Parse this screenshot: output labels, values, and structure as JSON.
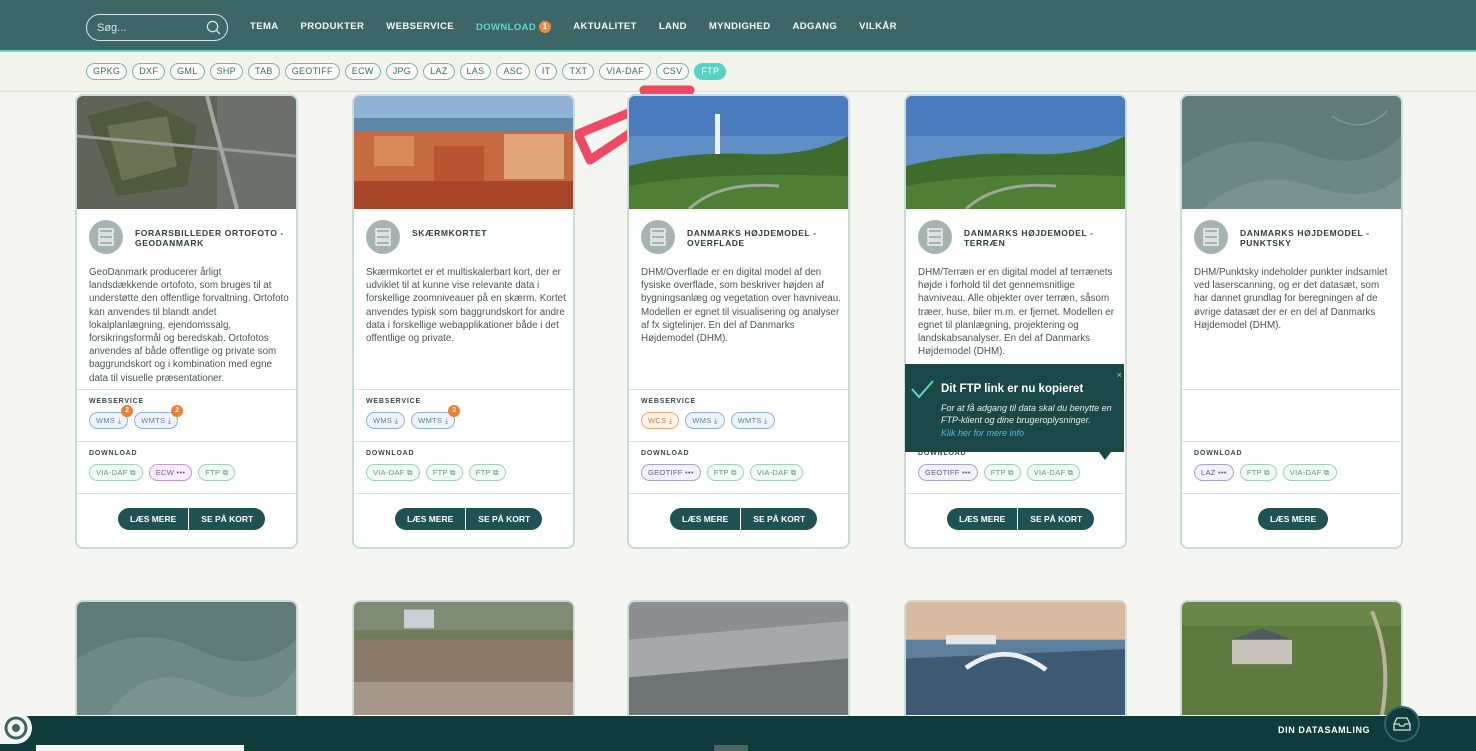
{
  "search": {
    "placeholder": "Søg..."
  },
  "nav": {
    "items": [
      "TEMA",
      "PRODUKTER",
      "WEBSERVICE",
      "DOWNLOAD",
      "AKTUALITET",
      "LAND",
      "MYNDIGHED",
      "ADGANG",
      "VILKÅR"
    ],
    "download_badge": "1"
  },
  "formats": [
    "GPKG",
    "DXF",
    "GML",
    "SHP",
    "TAB",
    "GEOTIFF",
    "ECW",
    "JPG",
    "LAZ",
    "LAS",
    "ASC",
    "IT",
    "TXT",
    "VIA-DAF",
    "CSV",
    "FTP"
  ],
  "active_format": "FTP",
  "section_labels": {
    "webservice": "WEBSERVICE",
    "download": "DOWNLOAD"
  },
  "buttons": {
    "read_more": "LÆS MERE",
    "see_map": "SE PÅ KORT"
  },
  "cards": [
    {
      "title": "FORARSBILLEDER ORTOFOTO - GEODANMARK",
      "description": "GeoDanmark producerer årligt landsdækkende ortofoto, som bruges til at understøtte den offentlige forvaltning. Ortofoto kan anvendes til blandt andet lokalplanlægning, ejendomssalg, forsikringsformål og beredskab. Ortofotos anvendes af både offentlige og private som baggrundskort og i kombination med egne data til visuelle præsentationer.",
      "webservice": [
        {
          "label": "WMS ⤓",
          "count": "2"
        },
        {
          "label": "WMTS ⤓",
          "count": "2"
        }
      ],
      "download": [
        {
          "label": "VIA-DAF ⧉",
          "type": "dl"
        },
        {
          "label": "ECW •••",
          "type": "ecw"
        },
        {
          "label": "FTP ⧉",
          "type": "dl"
        }
      ]
    },
    {
      "title": "SKÆRMKORTET",
      "description": "Skærmkortet er et multiskalerbart kort, der er udviklet til at kunne vise relevante data i forskellige zoomniveauer på en skærm. Kortet anvendes typisk som baggrundskort for andre data i forskellige webapplikationer både i det offentlige og private.",
      "webservice": [
        {
          "label": "WMS ⤓",
          "count": ""
        },
        {
          "label": "WMTS ⤓",
          "count": "3"
        }
      ],
      "download": [
        {
          "label": "VIA-DAF ⧉",
          "type": "dl"
        },
        {
          "label": "FTP ⧉",
          "type": "dl"
        },
        {
          "label": "FTP ⧉",
          "type": "dl"
        }
      ]
    },
    {
      "title": "DANMARKS HØJDEMODEL - OVERFLADE",
      "description": "DHM/Overflade er en digital model af den fysiske overflade, som beskriver højden af bygningsanlæg og vegetation over havniveau. Modellen er egnet til visualisering og analyser af fx sigtelinjer. En del af Danmarks Højdemodel (DHM).",
      "webservice": [
        {
          "label": "WCS ⤓",
          "count": "",
          "type": "wcs"
        },
        {
          "label": "WMS ⤓",
          "count": ""
        },
        {
          "label": "WMTS ⤓",
          "count": ""
        }
      ],
      "download": [
        {
          "label": "GEOTIFF •••",
          "type": "geo"
        },
        {
          "label": "FTP ⧉",
          "type": "dl"
        },
        {
          "label": "VIA-DAF ⧉",
          "type": "dl"
        }
      ]
    },
    {
      "title": "DANMARKS HØJDEMODEL - TERRÆN",
      "description": "DHM/Terræn er en digital model af terrænets højde i forhold til det gennemsnitlige havniveau. Alle objekter over terræn, såsom træer, huse, biler m.m. er fjernet. Modellen er egnet til planlægning, projektering og landskabsanalyser. En del af Danmarks Højdemodel (DHM).",
      "webservice": [],
      "download": [
        {
          "label": "GEOTIFF •••",
          "type": "geo"
        },
        {
          "label": "FTP ⧉",
          "type": "dl"
        },
        {
          "label": "VIA-DAF ⧉",
          "type": "dl"
        }
      ]
    },
    {
      "title": "DANMARKS HØJDEMODEL - PUNKTSKY",
      "description": "DHM/Punktsky indeholder punkter indsamlet ved laserscanning, og er det datasæt, som har dannet grundlag for beregningen af de øvrige datasæt der er en del af Danmarks Højdemodel (DHM).",
      "webservice": [],
      "download": [
        {
          "label": "LAZ •••",
          "type": "geo"
        },
        {
          "label": "FTP ⧉",
          "type": "dl"
        },
        {
          "label": "VIA-DAF ⧉",
          "type": "dl"
        }
      ]
    }
  ],
  "toast": {
    "title": "Dit FTP link er nu kopieret",
    "message": "For at få adgang til data skal du benytte en FTP-klient og dine brugeroplysninger.",
    "link": "Klik her for mere info",
    "close": "×"
  },
  "footer": {
    "datasamling": "DIN DATASAMLING"
  }
}
